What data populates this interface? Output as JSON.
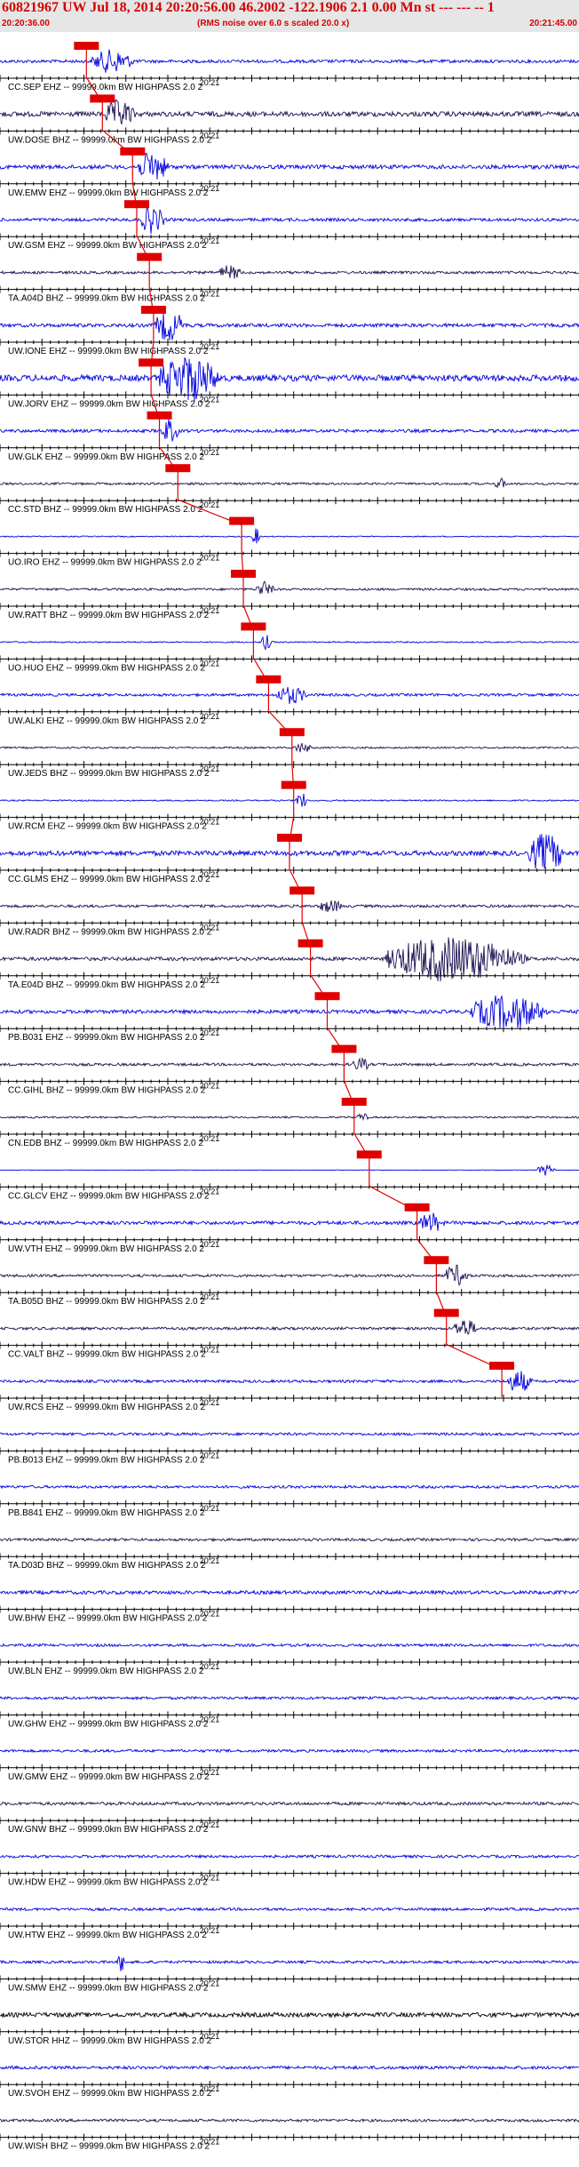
{
  "header": {
    "title": "60821967 UW Jul 18, 2014 20:20:56.00   46.2002 -122.1906  2.1 0.00 Mn st --- --- -- 1",
    "start_time": "20:20:36.00",
    "rms_note": "(RMS noise over 6.0 s scaled 20.0 x)",
    "end_time": "20:21:45.00"
  },
  "colors": {
    "blue_trace": "#0000e0",
    "dark_trace": "#1a1050",
    "black_trace": "#000000",
    "pick_box": "#e00000",
    "pick_line": "#e00000",
    "header_text": "#d40000",
    "header_bg": "#e6e6e6"
  },
  "chart_data": {
    "type": "seismogram",
    "minute_label": "20:21",
    "time_start_s": 0,
    "time_end_s": 69,
    "minute_mark_s": 24,
    "traces": [
      {
        "label": "CC.SEP EHZ -- 99999.0km BW  HIGHPASS  2.0  2",
        "color": "blue",
        "pick_s": 10.3,
        "amp": 0.35,
        "burst_s": 11,
        "burst_len": 7,
        "burst_amp": 1.2
      },
      {
        "label": "UW.DOSE BHZ -- 99999.0km BW  HIGHPASS  2.0  2",
        "color": "dark",
        "pick_s": 12.2,
        "amp": 0.55,
        "burst_s": 12.5,
        "burst_len": 5,
        "burst_amp": 1.4
      },
      {
        "label": "UW.EMW EHZ -- 99999.0km BW  HIGHPASS  2.0  2",
        "color": "blue",
        "pick_s": 15.8,
        "amp": 0.45,
        "burst_s": 16.5,
        "burst_len": 5,
        "burst_amp": 1.6
      },
      {
        "label": "UW.GSM EHZ -- 99999.0km BW  HIGHPASS  2.0  2",
        "color": "blue",
        "pick_s": 16.3,
        "amp": 0.35,
        "burst_s": 16.8,
        "burst_len": 4,
        "burst_amp": 1.5
      },
      {
        "label": "TA.A04D BHZ -- 99999.0km BW  HIGHPASS  2.0  2",
        "color": "dark",
        "pick_s": 17.8,
        "amp": 0.3,
        "burst_s": 26,
        "burst_len": 4,
        "burst_amp": 0.7
      },
      {
        "label": "UW.IONE EHZ -- 99999.0km BW  HIGHPASS  2.0  2",
        "color": "blue",
        "pick_s": 18.3,
        "amp": 0.4,
        "burst_s": 18.5,
        "burst_len": 5,
        "burst_amp": 1.6
      },
      {
        "label": "UW.JORV EHZ -- 99999.0km BW  HIGHPASS  2.0  2",
        "color": "blue",
        "pick_s": 18.0,
        "amp": 0.7,
        "burst_s": 19.0,
        "burst_len": 10,
        "burst_amp": 2.4
      },
      {
        "label": "UW.GLK EHZ -- 99999.0km BW  HIGHPASS  2.0  2",
        "color": "blue",
        "pick_s": 19.0,
        "amp": 0.35,
        "burst_s": 19.2,
        "burst_len": 3,
        "burst_amp": 1.2
      },
      {
        "label": "CC.STD BHZ -- 99999.0km BW  HIGHPASS  2.0  2",
        "color": "dark",
        "pick_s": 21.2,
        "amp": 0.25,
        "burst_s": 59,
        "burst_len": 2,
        "burst_amp": 0.5
      },
      {
        "label": "UO.IRO EHZ -- 99999.0km BW  HIGHPASS  2.0  2",
        "color": "blue",
        "pick_s": 28.8,
        "amp": 0.12,
        "burst_s": 30,
        "burst_len": 1.5,
        "burst_amp": 0.9
      },
      {
        "label": "UW.RATT BHZ -- 99999.0km BW  HIGHPASS  2.0  2",
        "color": "dark",
        "pick_s": 29.0,
        "amp": 0.25,
        "burst_s": 30.5,
        "burst_len": 3,
        "burst_amp": 0.8
      },
      {
        "label": "UO.HUO EHZ -- 99999.0km BW  HIGHPASS  2.0  2",
        "color": "blue",
        "pick_s": 30.2,
        "amp": 0.15,
        "burst_s": 31,
        "burst_len": 2,
        "burst_amp": 0.8
      },
      {
        "label": "UW.ALKI EHZ -- 99999.0km BW  HIGHPASS  2.0  2",
        "color": "blue",
        "pick_s": 32.0,
        "amp": 0.3,
        "burst_s": 33,
        "burst_len": 5,
        "burst_amp": 0.9
      },
      {
        "label": "UW.JEDS BHZ -- 99999.0km BW  HIGHPASS  2.0  2",
        "color": "dark",
        "pick_s": 34.8,
        "amp": 0.2,
        "burst_s": 35,
        "burst_len": 3,
        "burst_amp": 0.5
      },
      {
        "label": "UW.RCM EHZ -- 99999.0km BW  HIGHPASS  2.0  2",
        "color": "blue",
        "pick_s": 35.0,
        "amp": 0.15,
        "burst_s": 35.2,
        "burst_len": 2,
        "burst_amp": 0.9
      },
      {
        "label": "CC.GLMS EHZ -- 99999.0km BW  HIGHPASS  2.0  2",
        "color": "blue",
        "pick_s": 34.5,
        "amp": 0.55,
        "burst_s": 63,
        "burst_len": 6,
        "burst_amp": 2.0
      },
      {
        "label": "UW.RADR BHZ -- 99999.0km BW  HIGHPASS  2.0  2",
        "color": "dark",
        "pick_s": 36.0,
        "amp": 0.3,
        "burst_s": 38,
        "burst_len": 4,
        "burst_amp": 0.6
      },
      {
        "label": "TA.E04D BHZ -- 99999.0km BW  HIGHPASS  2.0  2",
        "color": "dark",
        "pick_s": 37.0,
        "amp": 0.4,
        "burst_s": 46,
        "burst_len": 23,
        "burst_amp": 2.4
      },
      {
        "label": "PB.B031 EHZ -- 99999.0km BW  HIGHPASS  2.0  2",
        "color": "blue",
        "pick_s": 39.0,
        "amp": 0.4,
        "burst_s": 56,
        "burst_len": 13,
        "burst_amp": 1.8
      },
      {
        "label": "CC.GIHL BHZ -- 99999.0km BW  HIGHPASS  2.0  2",
        "color": "dark",
        "pick_s": 41.0,
        "amp": 0.3,
        "burst_s": 42,
        "burst_len": 3,
        "burst_amp": 0.6
      },
      {
        "label": "CN.EDB BHZ -- 99999.0km BW  HIGHPASS  2.0  2",
        "color": "dark",
        "pick_s": 42.2,
        "amp": 0.2,
        "burst_s": 42.5,
        "burst_len": 2,
        "burst_amp": 0.4
      },
      {
        "label": "CC.GLCV EHZ -- 99999.0km BW  HIGHPASS  2.0  2",
        "color": "blue",
        "pick_s": 44.0,
        "amp": 0.05,
        "burst_s": 64,
        "burst_len": 3,
        "burst_amp": 0.6
      },
      {
        "label": "UW.VTH EHZ -- 99999.0km BW  HIGHPASS  2.0  2",
        "color": "blue",
        "pick_s": 49.7,
        "amp": 0.4,
        "burst_s": 50,
        "burst_len": 4,
        "burst_amp": 1.0
      },
      {
        "label": "TA.B05D BHZ -- 99999.0km BW  HIGHPASS  2.0  2",
        "color": "dark",
        "pick_s": 52.0,
        "amp": 0.3,
        "burst_s": 53,
        "burst_len": 4,
        "burst_amp": 1.1
      },
      {
        "label": "CC.VALT BHZ -- 99999.0km BW  HIGHPASS  2.0  2",
        "color": "dark",
        "pick_s": 53.2,
        "amp": 0.3,
        "burst_s": 54,
        "burst_len": 4,
        "burst_amp": 1.0
      },
      {
        "label": "UW.RCS EHZ -- 99999.0km BW  HIGHPASS  2.0  2",
        "color": "blue",
        "pick_s": 59.8,
        "amp": 0.3,
        "burst_s": 60.5,
        "burst_len": 4,
        "burst_amp": 1.2
      },
      {
        "label": "PB.B013 EHZ -- 99999.0km BW  HIGHPASS  2.0  2",
        "color": "blue",
        "pick_s": null,
        "amp": 0.3,
        "burst_s": null,
        "burst_len": 0,
        "burst_amp": 0
      },
      {
        "label": "PB.B841 EHZ -- 99999.0km BW  HIGHPASS  2.0  2",
        "color": "blue",
        "pick_s": null,
        "amp": 0.3,
        "burst_s": null,
        "burst_len": 0,
        "burst_amp": 0
      },
      {
        "label": "TA.D03D BHZ -- 99999.0km BW  HIGHPASS  2.0  2",
        "color": "dark",
        "pick_s": null,
        "amp": 0.3,
        "burst_s": null,
        "burst_len": 0,
        "burst_amp": 0
      },
      {
        "label": "UW.BHW EHZ -- 99999.0km BW  HIGHPASS  2.0  2",
        "color": "blue",
        "pick_s": null,
        "amp": 0.4,
        "burst_s": null,
        "burst_len": 0,
        "burst_amp": 0
      },
      {
        "label": "UW.BLN EHZ -- 99999.0km BW  HIGHPASS  2.0  2",
        "color": "blue",
        "pick_s": null,
        "amp": 0.3,
        "burst_s": null,
        "burst_len": 0,
        "burst_amp": 0
      },
      {
        "label": "UW.GHW EHZ -- 99999.0km BW  HIGHPASS  2.0  2",
        "color": "blue",
        "pick_s": null,
        "amp": 0.3,
        "burst_s": null,
        "burst_len": 0,
        "burst_amp": 0
      },
      {
        "label": "UW.GMW EHZ -- 99999.0km BW  HIGHPASS  2.0  2",
        "color": "blue",
        "pick_s": null,
        "amp": 0.3,
        "burst_s": null,
        "burst_len": 0,
        "burst_amp": 0
      },
      {
        "label": "UW.GNW BHZ -- 99999.0km BW  HIGHPASS  2.0  2",
        "color": "dark",
        "pick_s": null,
        "amp": 0.35,
        "burst_s": null,
        "burst_len": 0,
        "burst_amp": 0
      },
      {
        "label": "UW.HDW EHZ -- 99999.0km BW  HIGHPASS  2.0  2",
        "color": "blue",
        "pick_s": null,
        "amp": 0.3,
        "burst_s": null,
        "burst_len": 0,
        "burst_amp": 0
      },
      {
        "label": "UW.HTW EHZ -- 99999.0km BW  HIGHPASS  2.0  2",
        "color": "blue",
        "pick_s": null,
        "amp": 0.3,
        "burst_s": null,
        "burst_len": 0,
        "burst_amp": 0
      },
      {
        "label": "UW.SMW EHZ -- 99999.0km BW  HIGHPASS  2.0  2",
        "color": "blue",
        "pick_s": null,
        "amp": 0.3,
        "burst_s": 14,
        "burst_len": 1.5,
        "burst_amp": 1.0
      },
      {
        "label": "UW.STOR HHZ -- 99999.0km BW  HIGHPASS  2.0  2",
        "color": "black",
        "pick_s": null,
        "amp": 0.5,
        "burst_s": null,
        "burst_len": 0,
        "burst_amp": 0
      },
      {
        "label": "UW.SVOH EHZ -- 99999.0km BW  HIGHPASS  2.0  2",
        "color": "blue",
        "pick_s": null,
        "amp": 0.35,
        "burst_s": null,
        "burst_len": 0,
        "burst_amp": 0
      },
      {
        "label": "UW.WISH BHZ -- 99999.0km BW  HIGHPASS  2.0  2",
        "color": "dark",
        "pick_s": null,
        "amp": 0.3,
        "burst_s": null,
        "burst_len": 0,
        "burst_amp": 0
      }
    ]
  }
}
